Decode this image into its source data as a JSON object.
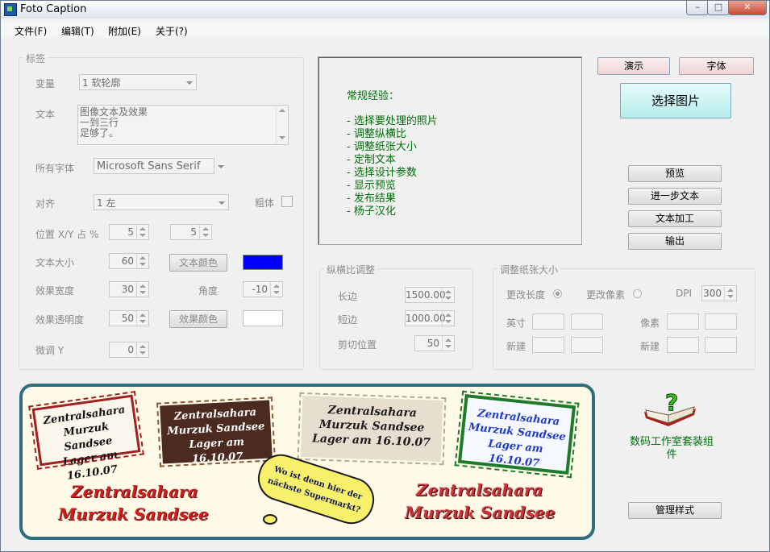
{
  "window": {
    "title": "Foto Caption",
    "min_label": "–",
    "max_label": "□",
    "close_label": "✕"
  },
  "menu": [
    "文件(F)",
    "编辑(T)",
    "附加(E)",
    "关于(?)"
  ],
  "label_group": {
    "title": "标签",
    "variable_label": "变量",
    "variable_value": "1 软轮廓",
    "text_label": "文本",
    "text_lines": [
      "图像文本及效果",
      "一到三行",
      "足够了。"
    ],
    "font_label": "所有字体",
    "font_value": "Microsoft Sans Serif",
    "align_label": "对齐",
    "align_value": "1 左",
    "bold_label": "粗体",
    "pos_label": "位置 X/Y 占 %",
    "pos_x": "5",
    "pos_y": "5",
    "size_label": "文本大小",
    "size_value": "60",
    "text_color_button": "文本颜色",
    "text_color": "#0000ff",
    "effect_width_label": "效果宽度",
    "effect_width_value": "30",
    "angle_label": "角度",
    "angle_value": "-10",
    "effect_opacity_label": "效果透明度",
    "effect_opacity_value": "50",
    "effect_color_button": "效果颜色",
    "effect_color": "#ffffff",
    "fine_y_label": "微调 Y",
    "fine_y_value": "0"
  },
  "info": {
    "heading": "常规经验：",
    "items": [
      "- 选择要处理的照片",
      "- 调整纵横比",
      "- 调整纸张大小",
      "- 定制文本",
      "- 选择设计参数",
      "- 显示预览",
      "- 发布结果",
      "- 杨子汉化"
    ]
  },
  "buttons": {
    "demo": "演示",
    "font": "字体",
    "select_image": "选择图片",
    "preview": "预览",
    "more_text": "进一步文本",
    "text_process": "文本加工",
    "output": "输出",
    "manage_styles": "管理样式"
  },
  "aspect_group": {
    "title": "纵横比调整",
    "long_label": "长边",
    "long_value": "1500.00",
    "short_label": "短边",
    "short_value": "1000.00",
    "crop_label": "剪切位置",
    "crop_value": "50"
  },
  "paper_group": {
    "title": "调整纸张大小",
    "change_length_label": "更改长度",
    "change_pixels_label": "更改像素",
    "dpi_label": "DPI",
    "dpi_value": "300",
    "inch_label": "英寸",
    "pixel_label": "像素",
    "new_label_1": "新建",
    "new_label_2": "新建"
  },
  "banner": {
    "stamp1": [
      "Zentralsahara",
      "Murzuk Sandsee",
      "Lager am 16.10.07"
    ],
    "stamp2": [
      "Zentralsahara",
      "Murzuk Sandsee",
      "Lager am 16.10.07"
    ],
    "stamp3": [
      "Zentralsahara",
      "Murzuk Sandsee",
      "Lager am 16.10.07"
    ],
    "stamp4": [
      "Zentralsahara",
      "Murzuk Sandsee",
      "Lager am 16.10.07"
    ],
    "bubble": [
      "Wo ist denn hier der",
      "nächste Supermarkt?"
    ],
    "red_left": [
      "Zentralsahara",
      "Murzuk Sandsee"
    ],
    "red_right": [
      "Zentralsahara",
      "Murzuk Sandsee"
    ]
  },
  "promo": {
    "text_line1": "数码工作室套装组",
    "text_line2": "件",
    "icon": "help-book-icon"
  }
}
